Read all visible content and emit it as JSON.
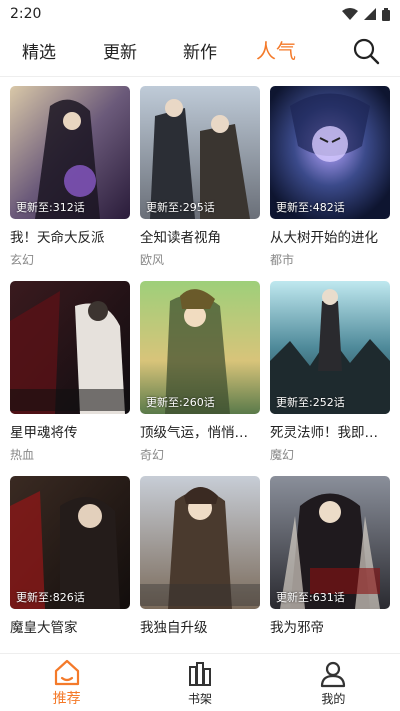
{
  "status": {
    "time": "2:20"
  },
  "tabs": [
    {
      "label": "精选"
    },
    {
      "label": "更新"
    },
    {
      "label": "新作"
    },
    {
      "label": "人气"
    }
  ],
  "active_tab": "人气",
  "colors": {
    "accent": "#f47a2a"
  },
  "comics": [
    {
      "title": "我！天命大反派",
      "genre": "玄幻",
      "episode": "更新至:312话"
    },
    {
      "title": "全知读者视角",
      "genre": "欧风",
      "episode": "更新至:295话"
    },
    {
      "title": "从大树开始的进化",
      "genre": "都市",
      "episode": "更新至:482话"
    },
    {
      "title": "星甲魂将传",
      "genre": "热血",
      "episode": ""
    },
    {
      "title": "顶级气运，悄悄修炼千年",
      "genre": "奇幻",
      "episode": "更新至:260话"
    },
    {
      "title": "死灵法师！我即是天灾",
      "genre": "魔幻",
      "episode": "更新至:252话"
    },
    {
      "title": "魔皇大管家",
      "genre": "",
      "episode": "更新至:826话"
    },
    {
      "title": "我独自升级",
      "genre": "",
      "episode": ""
    },
    {
      "title": "我为邪帝",
      "genre": "",
      "episode": "更新至:631话"
    }
  ],
  "bottom_nav": [
    {
      "label": "推荐",
      "icon": "home-icon"
    },
    {
      "label": "书架",
      "icon": "bookshelf-icon"
    },
    {
      "label": "我的",
      "icon": "profile-icon"
    }
  ]
}
